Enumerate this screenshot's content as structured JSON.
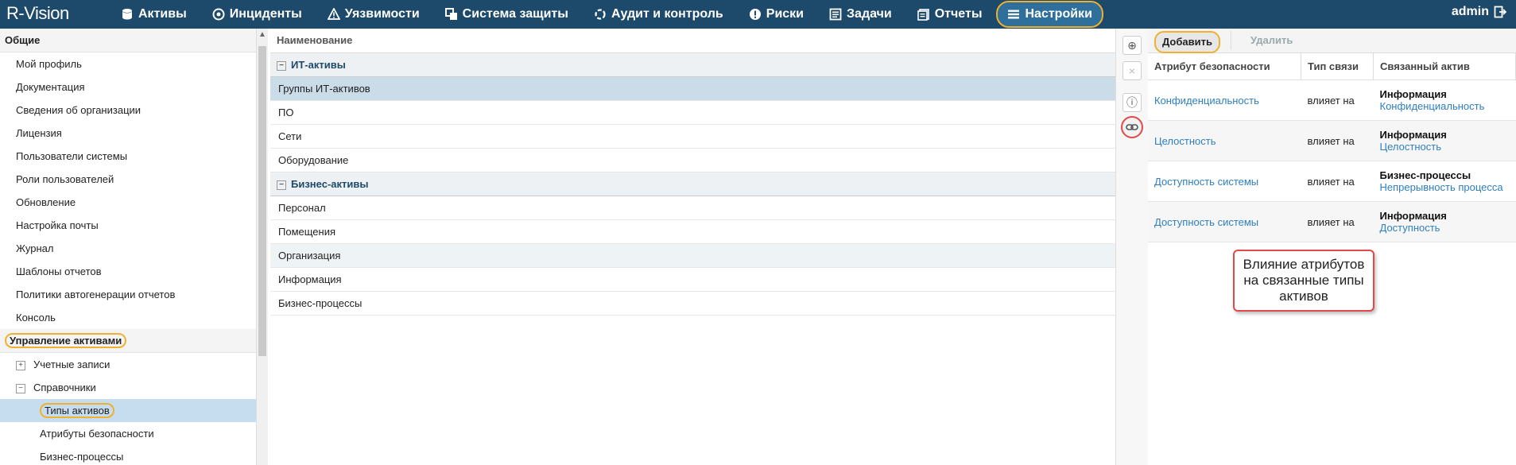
{
  "app": {
    "logo": "R-Vision"
  },
  "nav": {
    "items": [
      {
        "label": "Активы",
        "icon": "database-icon"
      },
      {
        "label": "Инциденты",
        "icon": "target-icon"
      },
      {
        "label": "Уязвимости",
        "icon": "warning-icon"
      },
      {
        "label": "Система защиты",
        "icon": "layers-icon"
      },
      {
        "label": "Аудит и контроль",
        "icon": "refresh-icon"
      },
      {
        "label": "Риски",
        "icon": "alert-circle-icon"
      },
      {
        "label": "Задачи",
        "icon": "tasks-icon"
      },
      {
        "label": "Отчеты",
        "icon": "reports-icon"
      },
      {
        "label": "Настройки",
        "icon": "menu-icon"
      }
    ],
    "active": "Настройки",
    "user": "admin"
  },
  "sidebar": {
    "section_general": "Общие",
    "general_items": [
      "Мой профиль",
      "Документация",
      "Сведения об организации",
      "Лицензия",
      "Пользователи системы",
      "Роли пользователей",
      "Обновление",
      "Настройка почты",
      "Журнал",
      "Шаблоны отчетов",
      "Политики автогенерации отчетов",
      "Консоль"
    ],
    "section_assets": "Управление активами",
    "accounts": "Учетные записи",
    "directories": "Справочники",
    "asset_types": "Типы активов",
    "security_attributes": "Атрибуты безопасности",
    "business_processes": "Бизнес-процессы"
  },
  "middle": {
    "header": "Наименование",
    "groups": [
      {
        "label": "ИТ-активы",
        "rows": [
          "Группы ИТ-активов",
          "ПО",
          "Сети",
          "Оборудование"
        ]
      },
      {
        "label": "Бизнес-активы",
        "rows": [
          "Персонал",
          "Помещения",
          "Организация",
          "Информация",
          "Бизнес-процессы"
        ]
      }
    ]
  },
  "right": {
    "add_label": "Добавить",
    "delete_label": "Удалить",
    "columns": [
      "Атрибут безопасности",
      "Тип связи",
      "Связанный актив"
    ],
    "rows": [
      {
        "attribute": "Конфиденциальность",
        "link_type": "влияет на",
        "asset_type": "Информация",
        "asset_attr": "Конфиденциальность"
      },
      {
        "attribute": "Целостность",
        "link_type": "влияет на",
        "asset_type": "Информация",
        "asset_attr": "Целостность"
      },
      {
        "attribute": "Доступность системы",
        "link_type": "влияет на",
        "asset_type": "Бизнес-процессы",
        "asset_attr": "Непрерывность процесса"
      },
      {
        "attribute": "Доступность системы",
        "link_type": "влияет на",
        "asset_type": "Информация",
        "asset_attr": "Доступность"
      }
    ],
    "callout": "Влияние атрибутов на связанные типы активов"
  }
}
